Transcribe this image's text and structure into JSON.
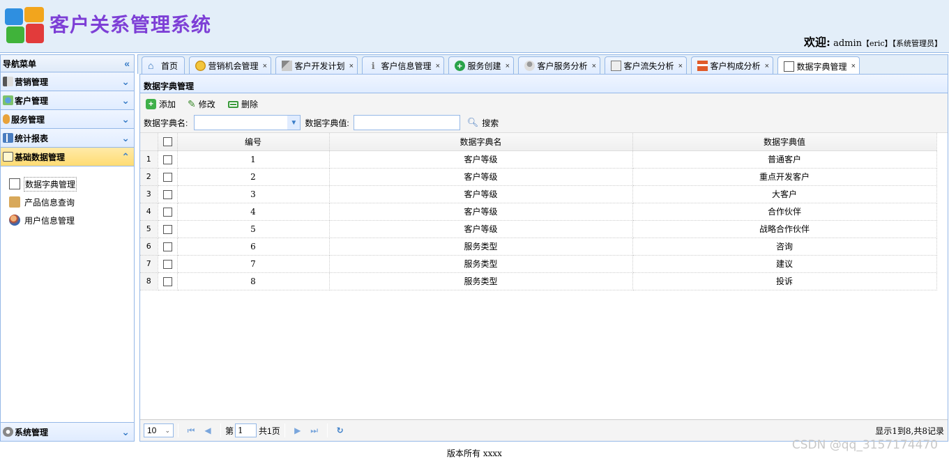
{
  "header": {
    "title": "客户关系管理系统",
    "welcome_label": "欢迎:",
    "user": "admin",
    "nickname": "【eric】",
    "role": "【系统管理员】"
  },
  "nav": {
    "title": "导航菜单",
    "sections": [
      {
        "label": "营销管理",
        "icon": "marketing-icon"
      },
      {
        "label": "客户管理",
        "icon": "customer-icon"
      },
      {
        "label": "服务管理",
        "icon": "service-icon"
      },
      {
        "label": "统计报表",
        "icon": "report-icon"
      },
      {
        "label": "基础数据管理",
        "icon": "basic-data-icon",
        "active": true
      }
    ],
    "items": [
      {
        "label": "数据字典管理",
        "icon": "dictionary-icon"
      },
      {
        "label": "产品信息查询",
        "icon": "product-icon"
      },
      {
        "label": "用户信息管理",
        "icon": "user-icon"
      }
    ],
    "bottom": {
      "label": "系统管理",
      "icon": "settings-icon"
    }
  },
  "tabs": [
    {
      "label": "首页",
      "icon": "home-icon",
      "closable": false
    },
    {
      "label": "营销机会管理",
      "icon": "coins-icon",
      "closable": true
    },
    {
      "label": "客户开发计划",
      "icon": "plan-icon",
      "closable": true
    },
    {
      "label": "客户信息管理",
      "icon": "info-icon",
      "closable": true
    },
    {
      "label": "服务创建",
      "icon": "add-service-icon",
      "closable": true
    },
    {
      "label": "客户服务分析",
      "icon": "analysis-icon",
      "closable": true
    },
    {
      "label": "客户流失分析",
      "icon": "loss-icon",
      "closable": true
    },
    {
      "label": "客户构成分析",
      "icon": "structure-icon",
      "closable": true
    },
    {
      "label": "数据字典管理",
      "icon": "dictionary-icon",
      "closable": true,
      "active": true
    }
  ],
  "close_glyph": "×",
  "panel": {
    "title": "数据字典管理",
    "toolbar": {
      "add": "添加",
      "edit": "修改",
      "delete": "删除",
      "search": "搜索"
    },
    "filters": {
      "name_label": "数据字典名:",
      "value_label": "数据字典值:"
    }
  },
  "grid": {
    "columns": [
      "编号",
      "数据字典名",
      "数据字典值"
    ],
    "rows": [
      {
        "rn": "1",
        "id": "1",
        "name": "客户等级",
        "value": "普通客户"
      },
      {
        "rn": "2",
        "id": "2",
        "name": "客户等级",
        "value": "重点开发客户"
      },
      {
        "rn": "3",
        "id": "3",
        "name": "客户等级",
        "value": "大客户"
      },
      {
        "rn": "4",
        "id": "4",
        "name": "客户等级",
        "value": "合作伙伴"
      },
      {
        "rn": "5",
        "id": "5",
        "name": "客户等级",
        "value": "战略合作伙伴"
      },
      {
        "rn": "6",
        "id": "6",
        "name": "服务类型",
        "value": "咨询"
      },
      {
        "rn": "7",
        "id": "7",
        "name": "服务类型",
        "value": "建议"
      },
      {
        "rn": "8",
        "id": "8",
        "name": "服务类型",
        "value": "投诉"
      }
    ]
  },
  "pager": {
    "page_size": "10",
    "page_prefix": "第",
    "page": "1",
    "page_suffix": "共1页",
    "info": "显示1到8,共8记录"
  },
  "footer": "版本所有 xxxx",
  "watermark": "CSDN @qq_3157174470"
}
